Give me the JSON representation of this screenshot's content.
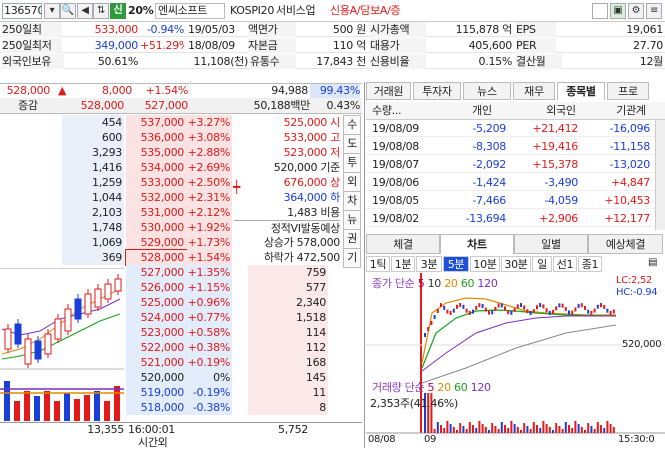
{
  "toolbar": {
    "code": "136570",
    "shin": "신",
    "margin": "20%",
    "name": "엔씨소프트",
    "market": "KOSPI20",
    "sector": "서비스업",
    "flags": "신용A/담보A/증"
  },
  "info": {
    "r1": [
      "250일최",
      "533,000",
      "-0.94%",
      "19/05/03",
      "액면가",
      "500 원",
      "시가총액",
      "115,878 억",
      "EPS",
      "19,061"
    ],
    "r2": [
      "250일최저",
      "349,000",
      "+51.29%",
      "18/08/09",
      "자본금",
      "110 억",
      "대용가",
      "405,600",
      "PER",
      "27.70"
    ],
    "r3": [
      "외국인보유",
      "50.61%",
      "11,108(천)",
      "유통수",
      "17,843 천",
      "신용비율",
      "0.15%",
      "결산월",
      "12월"
    ]
  },
  "quote": {
    "price": "528,000",
    "arrow": "▲",
    "change": "8,000",
    "pct": "+1.54%",
    "volume": "94,988",
    "ratio": "99.43%"
  },
  "qhead": {
    "lbl": "증감",
    "p1": "528,000",
    "p2": "527,000",
    "amt": "50,188백만",
    "pct": "0.43%"
  },
  "asks": [
    {
      "vol": "454",
      "price": "537,000",
      "pct": "+3.27%"
    },
    {
      "vol": "600",
      "price": "536,000",
      "pct": "+3.08%"
    },
    {
      "vol": "3,293",
      "price": "535,000",
      "pct": "+2.88%"
    },
    {
      "vol": "1,416",
      "price": "534,000",
      "pct": "+2.69%"
    },
    {
      "vol": "1,259",
      "price": "533,000",
      "pct": "+2.50%"
    },
    {
      "vol": "1,044",
      "price": "532,000",
      "pct": "+2.31%"
    },
    {
      "vol": "2,103",
      "price": "531,000",
      "pct": "+2.12%"
    },
    {
      "vol": "1,748",
      "price": "530,000",
      "pct": "+1.92%"
    },
    {
      "vol": "1,069",
      "price": "529,000",
      "pct": "+1.73%"
    },
    {
      "vol": "369",
      "price": "528,000",
      "pct": "+1.54%"
    }
  ],
  "bids": [
    {
      "price": "527,000",
      "pct": "+1.35%",
      "vol": "759"
    },
    {
      "price": "526,000",
      "pct": "+1.15%",
      "vol": "577"
    },
    {
      "price": "525,000",
      "pct": "+0.96%",
      "vol": "2,340"
    },
    {
      "price": "524,000",
      "pct": "+0.77%",
      "vol": "1,518"
    },
    {
      "price": "523,000",
      "pct": "+0.58%",
      "vol": "114"
    },
    {
      "price": "522,000",
      "pct": "+0.38%",
      "vol": "112"
    },
    {
      "price": "521,000",
      "pct": "+0.19%",
      "vol": "168"
    },
    {
      "price": "520,000",
      "pct": "0%",
      "vol": "145"
    },
    {
      "price": "519,000",
      "pct": "-0.19%",
      "vol": "11"
    },
    {
      "price": "518,000",
      "pct": "-0.38%",
      "vol": "8"
    }
  ],
  "side": {
    "s1": "525,000 시",
    "s2": "533,000 고",
    "s3": "523,000 저",
    "s4": "520,000 기준",
    "s5": "676,000 상",
    "s6": "364,000 하",
    "s7": "1,483 비용",
    "s8": "정적VI발동예상",
    "s9": "상승가 578,000",
    "s10": "하락가 472,500"
  },
  "vtabs": [
    "수",
    "도",
    "투",
    "외",
    "차",
    "뉴",
    "권",
    "기"
  ],
  "footer": {
    "total_ask": "13,355",
    "time": "16:00:01",
    "time_lbl": "시간외",
    "total_bid": "5,752"
  },
  "rtabs": [
    "거래원",
    "투자자",
    "뉴스",
    "재무",
    "종목별",
    "프로"
  ],
  "ivhead": {
    "c0": "수량...",
    "c1": "개인",
    "c2": "외국인",
    "c3": "기관계"
  },
  "investors": [
    {
      "date": "19/08/09",
      "ind": "-5,209",
      "for": "+21,412",
      "inst": "-16,096"
    },
    {
      "date": "19/08/08",
      "ind": "-8,308",
      "for": "+19,416",
      "inst": "-11,158"
    },
    {
      "date": "19/08/07",
      "ind": "-2,092",
      "for": "+15,378",
      "inst": "-13,020"
    },
    {
      "date": "19/08/06",
      "ind": "-1,424",
      "for": "-3,490",
      "inst": "+4,847"
    },
    {
      "date": "19/08/05",
      "ind": "-7,466",
      "for": "-4,059",
      "inst": "+10,453"
    },
    {
      "date": "19/08/02",
      "ind": "-13,694",
      "for": "+2,906",
      "inst": "+12,177"
    }
  ],
  "ctabs": [
    "체결",
    "차트",
    "일별",
    "예상체결"
  ],
  "ptabs": [
    "1틱",
    "1분",
    "3분",
    "5분",
    "10분",
    "30분",
    "일",
    "선1",
    "종1"
  ],
  "chart": {
    "legend_price": "종가 단순",
    "ma": [
      "5",
      "10",
      "20",
      "60",
      "120"
    ],
    "lc": "LC:2,52",
    "hc": "HC:-0.94",
    "tick": "520,000",
    "vol_legend": "거래량 단순",
    "vma": [
      "5",
      "20",
      "60",
      "120"
    ],
    "vol_val": "2,353주(41.46%)",
    "x1": "08/08",
    "x2": "09",
    "time": "15:30:0"
  },
  "colors": {
    "up": "#e21a1a",
    "down": "#1a3fd8"
  }
}
